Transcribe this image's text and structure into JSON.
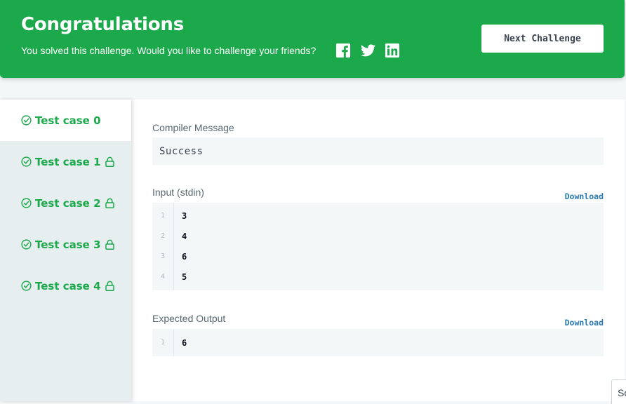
{
  "banner": {
    "title": "Congratulations",
    "subtitle": "You solved this challenge. Would you like to challenge your friends?",
    "social_icons": [
      "facebook-icon",
      "twitter-icon",
      "linkedin-icon"
    ],
    "next_button": "Next Challenge",
    "color": "#1ba94c"
  },
  "tabs": [
    {
      "label": "Test case 0",
      "locked": false,
      "active": true
    },
    {
      "label": "Test case 1",
      "locked": true,
      "active": false
    },
    {
      "label": "Test case 2",
      "locked": true,
      "active": false
    },
    {
      "label": "Test case 3",
      "locked": true,
      "active": false
    },
    {
      "label": "Test case 4",
      "locked": true,
      "active": false
    }
  ],
  "compiler": {
    "label": "Compiler Message",
    "message": "Success"
  },
  "input": {
    "label": "Input (stdin)",
    "download": "Download",
    "lines": [
      {
        "n": "1",
        "v": "3"
      },
      {
        "n": "2",
        "v": "4"
      },
      {
        "n": "3",
        "v": "6"
      },
      {
        "n": "4",
        "v": "5"
      }
    ]
  },
  "expected": {
    "label": "Expected Output",
    "download": "Download",
    "lines": [
      {
        "n": "1",
        "v": "6"
      }
    ]
  },
  "corner_tab": "Sc"
}
